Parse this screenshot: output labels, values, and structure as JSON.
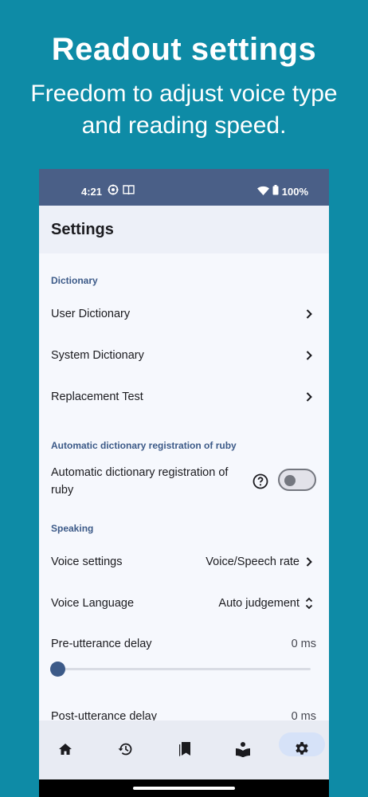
{
  "promo": {
    "title": "Readout settings",
    "subtitle": "Freedom to adjust voice type and reading speed."
  },
  "status_bar": {
    "time": "4:21",
    "battery": "100%",
    "icons": [
      "vpn-icon",
      "book-icon",
      "wifi-icon",
      "battery-icon"
    ]
  },
  "app_bar": {
    "title": "Settings"
  },
  "sections": {
    "dictionary": {
      "header": "Dictionary",
      "items": [
        "User Dictionary",
        "System Dictionary",
        "Replacement Test"
      ]
    },
    "ruby": {
      "header": "Automatic dictionary registration of ruby",
      "toggle_label": "Automatic dictionary registration of ruby",
      "toggle_on": false
    },
    "speaking": {
      "header": "Speaking",
      "voice_settings": {
        "label": "Voice settings",
        "value": "Voice/Speech rate"
      },
      "voice_language": {
        "label": "Voice Language",
        "value": "Auto judgement"
      },
      "pre_delay": {
        "label": "Pre-utterance delay",
        "value": "0 ms",
        "level": 0
      },
      "post_delay": {
        "label": "Post-utterance delay",
        "value": "0 ms"
      }
    }
  },
  "bottom_nav": {
    "items": [
      "home-icon",
      "history-icon",
      "bookmarks-icon",
      "reading-icon",
      "settings-icon"
    ],
    "active": "settings-icon"
  },
  "colors": {
    "background": "#0e8ba6",
    "status_bar": "#4a5f87",
    "accent": "#3c5a88",
    "surface": "#f6f8fd"
  }
}
